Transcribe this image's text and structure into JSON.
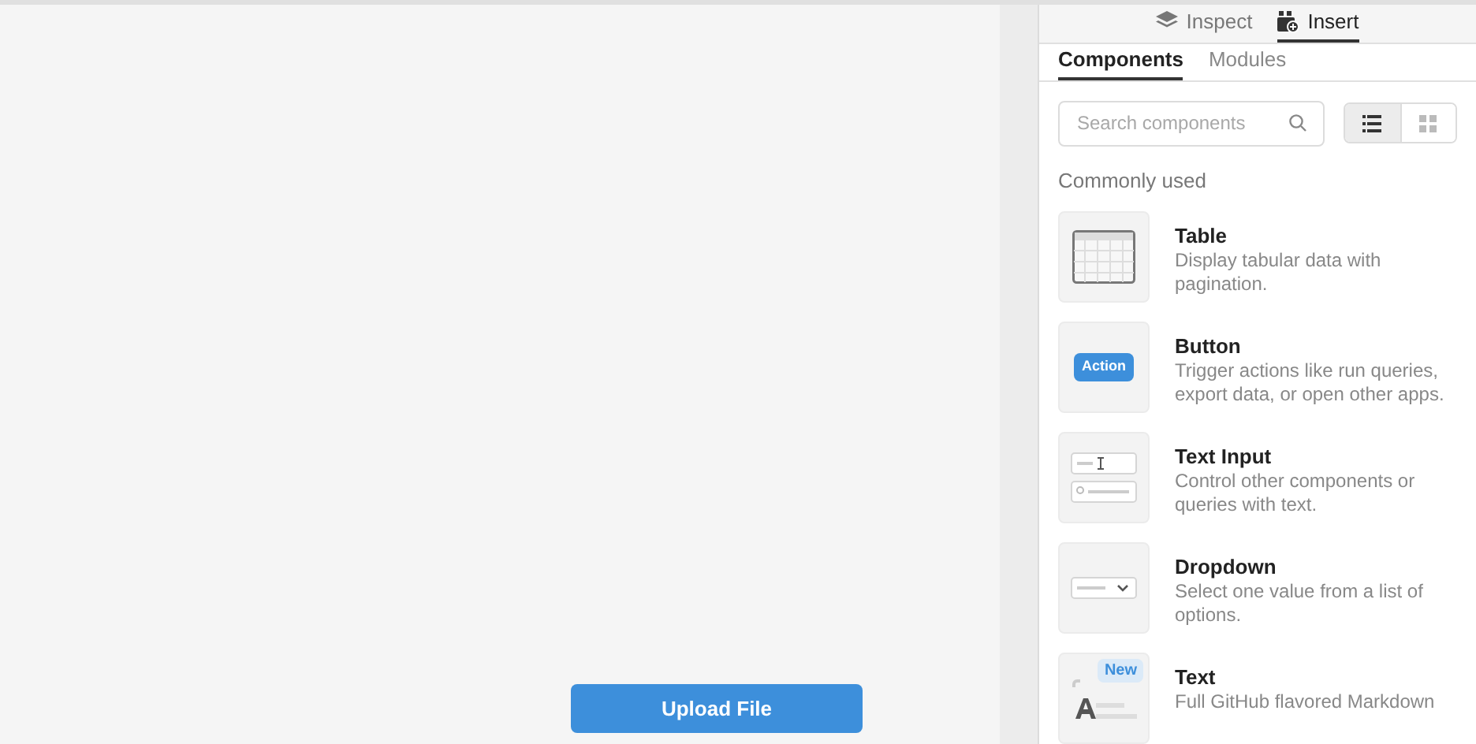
{
  "canvas": {
    "upload_button": "Upload File"
  },
  "panel_tabs": [
    {
      "label": "Inspect",
      "kind": "layers",
      "selected": false
    },
    {
      "label": "Insert",
      "kind": "insert",
      "selected": true
    }
  ],
  "sub_tabs": [
    {
      "label": "Components",
      "selected": true
    },
    {
      "label": "Modules",
      "selected": false
    }
  ],
  "search": {
    "placeholder": "Search components"
  },
  "view_toggle": [
    {
      "kind": "list",
      "selected": true
    },
    {
      "kind": "grid",
      "selected": false
    }
  ],
  "section_title": "Commonly used",
  "components": [
    {
      "kind": "table",
      "name": "Table",
      "description": "Display tabular data with pagination."
    },
    {
      "kind": "button",
      "name": "Button",
      "description": "Trigger actions like run queries, export data, or open other apps.",
      "preview_label": "Action"
    },
    {
      "kind": "text_input",
      "name": "Text Input",
      "description": "Control other components or queries with text."
    },
    {
      "kind": "dropdown",
      "name": "Dropdown",
      "description": "Select one value from a list of options."
    },
    {
      "kind": "text",
      "name": "Text",
      "description": "Full GitHub flavored Markdown",
      "badge": "New"
    }
  ]
}
